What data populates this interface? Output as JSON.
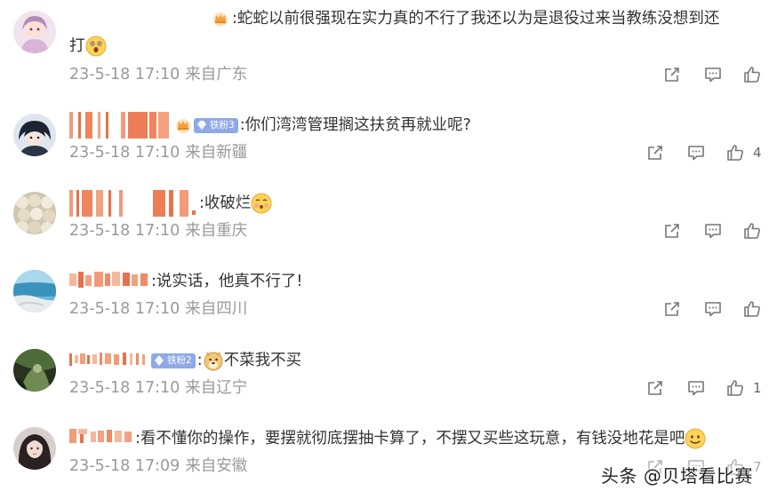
{
  "comments": [
    {
      "text": "蛇蛇以前很强现在实力真的不行了我还以为是退役过来当教练没想到还",
      "text2": "打",
      "date": "23-5-18 17:10",
      "location": "来自广东",
      "likes": ""
    },
    {
      "badge": "铁粉3",
      "text": "你们湾湾管理搁这扶贫再就业呢?",
      "date": "23-5-18 17:10",
      "location": "来自新疆",
      "likes": "4"
    },
    {
      "text": "收破烂",
      "date": "23-5-18 17:10",
      "location": "来自重庆",
      "likes": ""
    },
    {
      "text": "说实话，他真不行了!",
      "date": "23-5-18 17:10",
      "location": "来自四川",
      "likes": ""
    },
    {
      "badge": "铁粉2",
      "text": "不菜我不买",
      "date": "23-5-18 17:10",
      "location": "来自辽宁",
      "likes": "1"
    },
    {
      "text": "看不懂你的操作，要摆就彻底摆抽卡算了，不摆又买些这玩意，有钱没地花是吧",
      "date": "23-5-18 17:09",
      "location": "来自安徽",
      "likes": "7"
    }
  ],
  "icons": {
    "share": "share-icon",
    "comment": "comment-icon",
    "like": "like-icon",
    "crown": "crown-icon",
    "fan_badge": "fan-badge-icon"
  },
  "colors": {
    "meta": "#9a9a9a",
    "badge": "#8ea9e6",
    "redacted_name": "#e8724a"
  },
  "watermark": "头条 @贝塔看比赛"
}
